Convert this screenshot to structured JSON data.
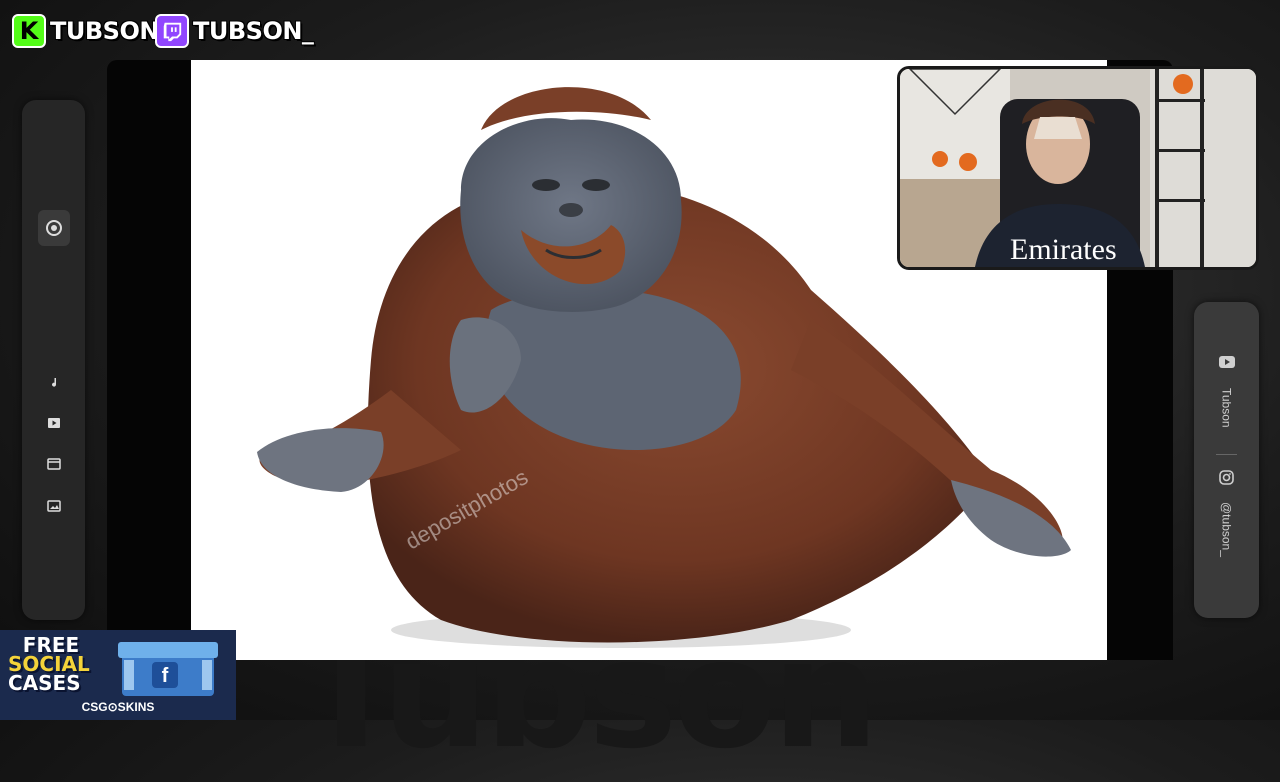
{
  "top_badges": {
    "kick": {
      "logo_letter": "K",
      "name": "TUBSON",
      "color": "#53fc18"
    },
    "twitch": {
      "logo_icon": "twitch-icon",
      "name": "TUBSON_",
      "color": "#9146ff"
    }
  },
  "watermark": {
    "text": "Tubson"
  },
  "stage": {
    "image": "orangutan-photo",
    "overlay_text": "depositphotos"
  },
  "left_sidebar": {
    "icons": [
      "camera-icon",
      "music-note-icon",
      "video-play-icon",
      "film-icon",
      "image-icon"
    ]
  },
  "right_sidebar": {
    "youtube": {
      "icon": "youtube-icon",
      "label": "Tubson"
    },
    "instagram": {
      "icon": "instagram-icon",
      "label": "@tubson_"
    }
  },
  "webcam": {
    "shirt_text": "Emirates"
  },
  "sponsor": {
    "line1": "FREE",
    "line2": "SOCIAL",
    "line3": "CASES",
    "brand": "CSG⊙SKINS",
    "colors": {
      "highlight": "#f4d33a",
      "background": "#1b2a4d"
    }
  }
}
